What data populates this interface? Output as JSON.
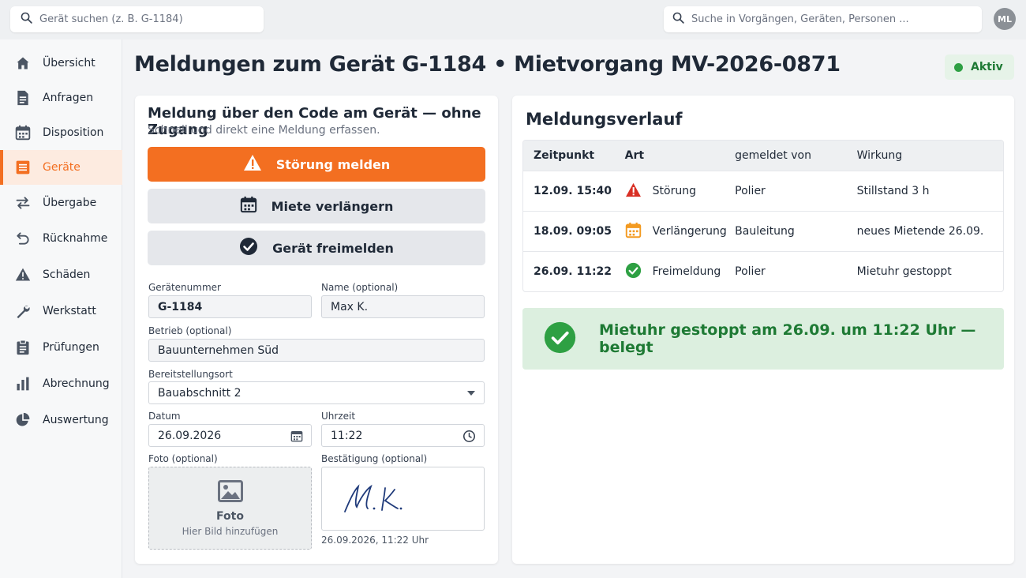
{
  "topbar": {
    "device_search_placeholder": "Gerät suchen (z. B. G-1184)",
    "global_search_placeholder": "Suche in Vorgängen, Geräten, Personen ...",
    "avatar_initials": "ML"
  },
  "sidebar": {
    "items": [
      {
        "label": "Übersicht",
        "icon": "home-icon"
      },
      {
        "label": "Anfragen",
        "icon": "document-icon"
      },
      {
        "label": "Disposition",
        "icon": "calendar-icon"
      },
      {
        "label": "Geräte",
        "icon": "list-icon",
        "active": true
      },
      {
        "label": "Übergabe",
        "icon": "swap-arrows-icon"
      },
      {
        "label": "Rücknahme",
        "icon": "return-arrow-icon"
      },
      {
        "label": "Schäden",
        "icon": "warning-icon"
      },
      {
        "label": "Werkstatt",
        "icon": "wrench-icon"
      },
      {
        "label": "Prüfungen",
        "icon": "clipboard-icon"
      },
      {
        "label": "Abrechnung",
        "icon": "bar-chart-icon"
      },
      {
        "label": "Auswertung",
        "icon": "pie-chart-icon"
      }
    ]
  },
  "header": {
    "title": "Meldungen zum Gerät G-1184 • Mietvorgang MV-2026-0871",
    "status": "Aktiv"
  },
  "report_form": {
    "title": "Meldung über den Code am Gerät — ohne Zugang",
    "subtitle": "Schnell und direkt eine Meldung erfassen.",
    "actions": {
      "report_fault": "Störung melden",
      "extend_rental": "Miete verlängern",
      "release_device": "Gerät freimelden"
    },
    "fields": {
      "device_number_label": "Gerätenummer",
      "device_number_value": "G-1184",
      "name_label": "Name (optional)",
      "name_value": "Max K.",
      "company_label": "Betrieb (optional)",
      "company_value": "Bauunternehmen Süd",
      "location_label": "Bereitstellungsort",
      "location_value": "Bauabschnitt 2",
      "date_label": "Datum",
      "date_value": "26.09.2026",
      "time_label": "Uhrzeit",
      "time_value": "11:22",
      "photo_label": "Foto (optional)",
      "photo_title": "Foto",
      "photo_hint": "Hier Bild hinzufügen",
      "confirmation_label": "Bestätigung (optional)",
      "signature_text": "M. K.",
      "confirmation_timestamp": "26.09.2026, 11:22 Uhr"
    }
  },
  "history": {
    "title": "Meldungsverlauf",
    "columns": [
      "Zeitpunkt",
      "Art",
      "gemeldet von",
      "Wirkung"
    ],
    "rows": [
      {
        "time": "12.09. 15:40",
        "type": "Störung",
        "type_icon": "warning-red-icon",
        "reported_by": "Polier",
        "effect": "Stillstand 3 h"
      },
      {
        "time": "18.09. 09:05",
        "type": "Verlängerung",
        "type_icon": "calendar-orange-icon",
        "reported_by": "Bauleitung",
        "effect": "neues Mietende 26.09."
      },
      {
        "time": "26.09. 11:22",
        "type": "Freimeldung",
        "type_icon": "check-green-icon",
        "reported_by": "Polier",
        "effect": "Mietuhr gestoppt"
      }
    ],
    "confirmation": "Mietuhr gestoppt am 26.09. um 11:22 Uhr — belegt"
  },
  "colors": {
    "accent": "#f36f21",
    "success": "#2ea043",
    "danger": "#d93025"
  }
}
